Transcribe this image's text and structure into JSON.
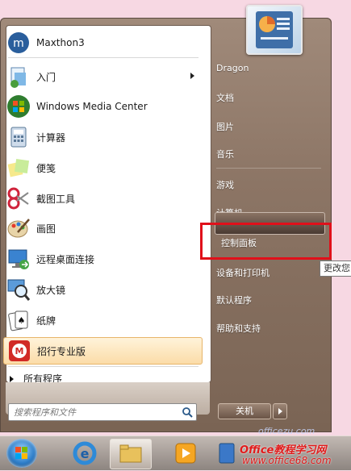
{
  "start_menu": {
    "programs": [
      {
        "label": "Maxthon3",
        "icon": "maxthon-icon"
      },
      {
        "label": "入门",
        "icon": "getting-started-icon",
        "submenu": true
      },
      {
        "label": "Windows Media Center",
        "icon": "windows-media-center-icon"
      },
      {
        "label": "计算器",
        "icon": "calculator-icon"
      },
      {
        "label": "便笺",
        "icon": "sticky-notes-icon"
      },
      {
        "label": "截图工具",
        "icon": "snipping-tool-icon"
      },
      {
        "label": "画图",
        "icon": "paint-icon"
      },
      {
        "label": "远程桌面连接",
        "icon": "remote-desktop-icon"
      },
      {
        "label": "放大镜",
        "icon": "magnifier-icon"
      },
      {
        "label": "纸牌",
        "icon": "solitaire-icon"
      },
      {
        "label": "招行专业版",
        "icon": "cmb-bank-icon",
        "highlighted": true
      }
    ],
    "all_programs": "所有程序",
    "search_placeholder": "搜索程序和文件"
  },
  "right_pane": {
    "user": "Dragon",
    "items": [
      "文档",
      "图片",
      "音乐",
      "游戏",
      "计算机",
      "控制面板",
      "设备和打印机",
      "默认程序",
      "帮助和支持"
    ],
    "highlighted": "控制面板",
    "tooltip": "更改您"
  },
  "shutdown_label": "关机",
  "watermark": {
    "line1": "officezu.com",
    "line2": "Office教程学习网",
    "line3": "www.office68.com"
  },
  "colors": {
    "highlight_box": "#e0101a",
    "menu_frame": "#8c7565"
  }
}
